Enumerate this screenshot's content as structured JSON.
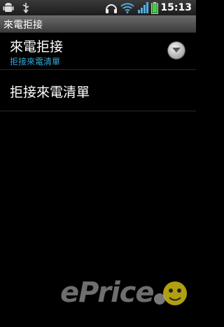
{
  "status_bar": {
    "time": "15:13",
    "icons": [
      "android-icon",
      "usb-icon",
      "headset-icon",
      "wifi-icon",
      "signal-icon",
      "battery-icon"
    ]
  },
  "title_bar": {
    "title": "來電拒接"
  },
  "settings": [
    {
      "title": "來電拒接",
      "summary": "拒接來電清單",
      "control": "dropdown-button"
    },
    {
      "title": "拒接來電清單"
    }
  ],
  "watermark": {
    "brand": "ePrice"
  },
  "colors": {
    "accent": "#33aadd",
    "background": "#000000",
    "titlebar": "#5a5a5a"
  }
}
